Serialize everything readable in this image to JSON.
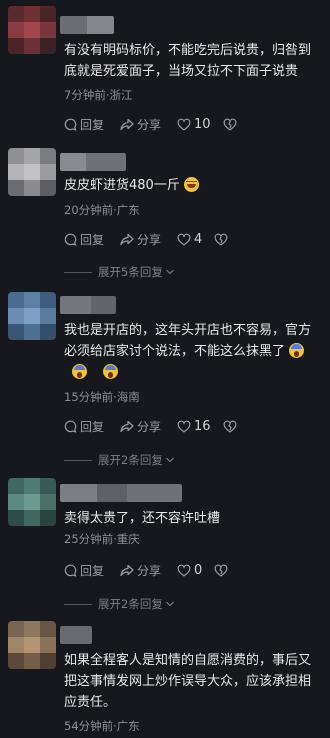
{
  "labels": {
    "reply": "回复",
    "share": "分享"
  },
  "comments": [
    {
      "text": "有没有明码标价，不能吃完后说贵，归咎到底就是死爱面子，当场又拉不下面子说贵",
      "meta": "7分钟前·浙江",
      "likes": "10",
      "expand": ""
    },
    {
      "text": "皮皮虾进货480一斤",
      "emoji": "laughing-emoji",
      "meta": "20分钟前·广东",
      "likes": "4",
      "expand": "展开5条回复"
    },
    {
      "text": "我也是开店的，这年头开店也不容易，官方必须给店家讨个说法，不能这么抹黑了",
      "emoji": "screaming-emoji",
      "meta": "15分钟前·海南",
      "likes": "16",
      "expand": "展开2条回复"
    },
    {
      "text": "卖得太贵了，还不容许吐槽",
      "meta": "25分钟前·重庆",
      "likes": "0",
      "expand": "展开2条回复"
    },
    {
      "text": "如果全程客人是知情的自愿消费的，事后又把这事情发网上炒作误导大众，应该承担相应责任。",
      "meta": "54分钟前·广东",
      "likes": "",
      "expand": ""
    }
  ],
  "colors": {
    "background": "#17181d",
    "text": "#e8e8ea",
    "meta": "#8d8e93"
  }
}
